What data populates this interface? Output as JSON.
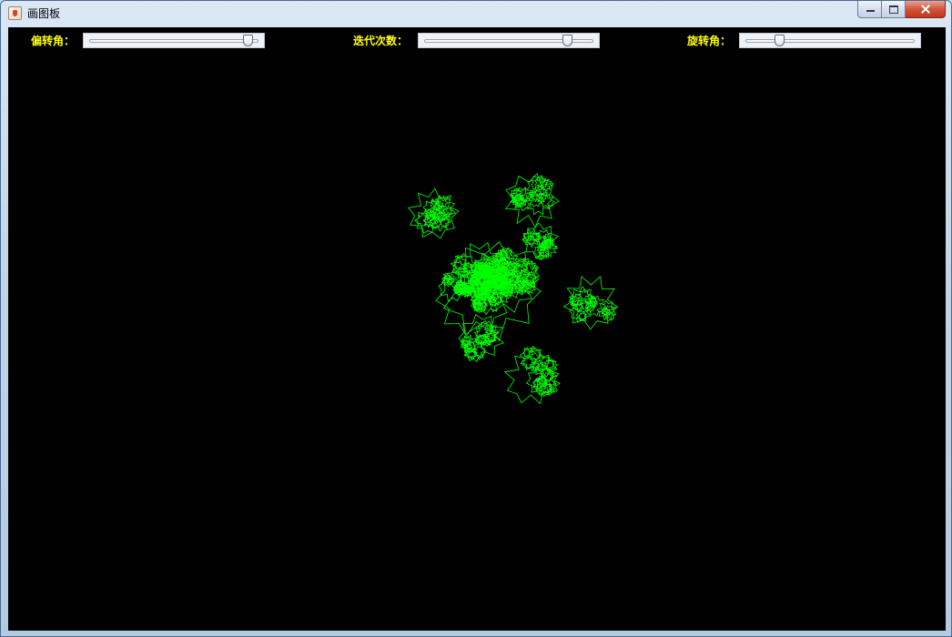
{
  "window": {
    "title": "画图板",
    "icon": "java-cup-icon"
  },
  "controls": [
    {
      "label": "偏转角：",
      "value_fraction": 0.93
    },
    {
      "label": "迭代次数：",
      "value_fraction": 0.84
    },
    {
      "label": "旋转角：",
      "value_fraction": 0.2
    }
  ],
  "drawing": {
    "background_color": "#000000",
    "stroke_color": "#00ff00",
    "label_color": "#ffff00"
  }
}
